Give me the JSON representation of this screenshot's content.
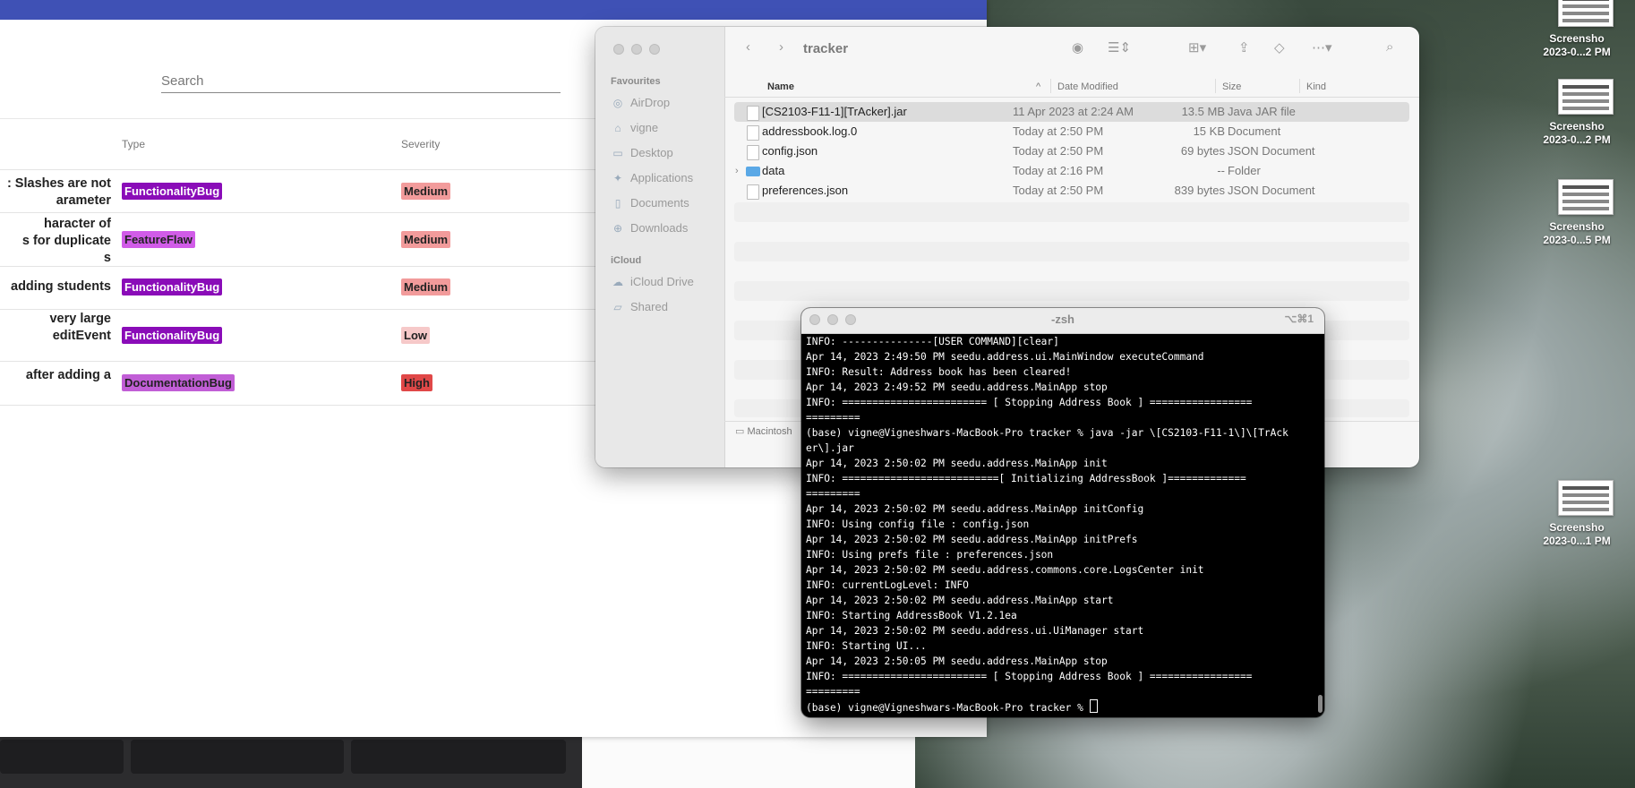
{
  "browser": {
    "search_placeholder": "Search",
    "columns": {
      "type": "Type",
      "severity": "Severity"
    },
    "issues": [
      {
        "title_lines": [
          ": Slashes are not",
          "arameter"
        ],
        "type": "FunctionalityBug",
        "severity": "Medium"
      },
      {
        "title_lines": [
          "haracter of",
          "s for duplicate",
          "s"
        ],
        "type": "FeatureFlaw",
        "severity": "Medium"
      },
      {
        "title_lines": [
          "adding students"
        ],
        "type": "FunctionalityBug",
        "severity": "Medium"
      },
      {
        "title_lines": [
          "very large",
          "editEvent"
        ],
        "type": "FunctionalityBug",
        "severity": "Low"
      },
      {
        "title_lines": [
          "after adding a"
        ],
        "type": "DocumentationBug",
        "severity": "High"
      }
    ],
    "colors": {
      "accent": "#3f51b5",
      "functionality": "#8a0cb8",
      "featureflaw": "#d15ce8",
      "documentation": "#c15ed6",
      "medium": "#f29b9b",
      "low": "#f6c9c9",
      "high": "#e04848"
    }
  },
  "finder": {
    "title": "tracker",
    "sidebar": {
      "favourites_label": "Favourites",
      "favourites": [
        "AirDrop",
        "vigne",
        "Desktop",
        "Applications",
        "Documents",
        "Downloads"
      ],
      "icloud_label": "iCloud",
      "icloud": [
        "iCloud Drive",
        "Shared"
      ]
    },
    "columns": {
      "name": "Name",
      "date": "Date Modified",
      "size": "Size",
      "kind": "Kind"
    },
    "files": [
      {
        "name": "[CS2103-F11-1][TrAcker].jar",
        "date": "11 Apr 2023 at 2:24 AM",
        "size": "13.5 MB",
        "kind": "Java JAR file"
      },
      {
        "name": "addressbook.log.0",
        "date": "Today at 2:50 PM",
        "size": "15 KB",
        "kind": "Document"
      },
      {
        "name": "config.json",
        "date": "Today at 2:50 PM",
        "size": "69 bytes",
        "kind": "JSON Document"
      },
      {
        "name": "data",
        "date": "Today at 2:16 PM",
        "size": "--",
        "kind": "Folder"
      },
      {
        "name": "preferences.json",
        "date": "Today at 2:50 PM",
        "size": "839 bytes",
        "kind": "JSON Document"
      }
    ],
    "status_path": "Macintosh"
  },
  "terminal": {
    "title": "-zsh",
    "shortcut": "⌥⌘1",
    "lines": [
      "INFO: ---------------[USER COMMAND][clear]",
      "Apr 14, 2023 2:49:50 PM seedu.address.ui.MainWindow executeCommand",
      "INFO: Result: Address book has been cleared!",
      "Apr 14, 2023 2:49:52 PM seedu.address.MainApp stop",
      "INFO: ======================== [ Stopping Address Book ] =================",
      "=========",
      "(base) vigne@Vigneshwars-MacBook-Pro tracker % java -jar \\[CS2103-F11-1\\]\\[TrAck",
      "er\\].jar",
      "Apr 14, 2023 2:50:02 PM seedu.address.MainApp init",
      "INFO: ==========================[ Initializing AddressBook ]=============",
      "=========",
      "Apr 14, 2023 2:50:02 PM seedu.address.MainApp initConfig",
      "INFO: Using config file : config.json",
      "Apr 14, 2023 2:50:02 PM seedu.address.MainApp initPrefs",
      "INFO: Using prefs file : preferences.json",
      "Apr 14, 2023 2:50:02 PM seedu.address.commons.core.LogsCenter init",
      "INFO: currentLogLevel: INFO",
      "Apr 14, 2023 2:50:02 PM seedu.address.MainApp start",
      "INFO: Starting AddressBook V1.2.1ea",
      "Apr 14, 2023 2:50:02 PM seedu.address.ui.UiManager start",
      "INFO: Starting UI...",
      "Apr 14, 2023 2:50:05 PM seedu.address.MainApp stop",
      "INFO: ======================== [ Stopping Address Book ] =================",
      "========="
    ],
    "prompt": "(base) vigne@Vigneshwars-MacBook-Pro tracker % "
  },
  "desktop": {
    "icons": [
      {
        "line1": "Screensho",
        "line2": "2023-0...2 PM"
      },
      {
        "line1": "Screensho",
        "line2": "2023-0...2 PM"
      },
      {
        "line1": "Screensho",
        "line2": "2023-0...5 PM"
      },
      {
        "line1": "Screensho",
        "line2": "2023-0...1 PM"
      }
    ]
  }
}
